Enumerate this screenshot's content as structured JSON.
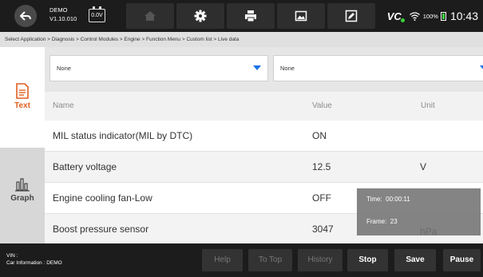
{
  "app": {
    "name": "DEMO",
    "version": "V1.10.010",
    "voltage": "0.0V"
  },
  "status": {
    "vci_label": "VC",
    "battery": "100%",
    "time": "10:43"
  },
  "breadcrumb": "Select Application > Diagnosis > Control Modules > Engine > Function Menu > Custom list >  Live data",
  "sidebar": {
    "tabs": [
      {
        "label": "Text",
        "active": true
      },
      {
        "label": "Graph",
        "active": false
      }
    ]
  },
  "selectors": [
    {
      "value": "None"
    },
    {
      "value": "None"
    }
  ],
  "table": {
    "headers": {
      "name": "Name",
      "value": "Value",
      "unit": "Unit"
    },
    "rows": [
      {
        "name": "MIL status indicator(MIL by DTC)",
        "value": "ON",
        "unit": ""
      },
      {
        "name": "Battery voltage",
        "value": "12.5",
        "unit": "V"
      },
      {
        "name": "Engine cooling fan-Low",
        "value": "OFF",
        "unit": ""
      },
      {
        "name": "Boost pressure sensor",
        "value": "3047",
        "unit": "hPa"
      }
    ]
  },
  "tooltip": {
    "time_label": "Time:",
    "time_value": "00:00:11",
    "frame_label": "Frame:",
    "frame_value": "23"
  },
  "footer": {
    "vin_label": "VIN :",
    "car_info_label": "Car Information :",
    "car_info_value": "DEMO",
    "buttons": [
      {
        "label": "Help",
        "enabled": false
      },
      {
        "label": "To Top",
        "enabled": false
      },
      {
        "label": "History",
        "enabled": false
      },
      {
        "label": "Stop",
        "enabled": true
      },
      {
        "label": "Save",
        "enabled": true
      },
      {
        "label": "Pause",
        "enabled": true
      }
    ]
  },
  "colors": {
    "accent_orange": "#e06020",
    "dropdown_blue": "#1a73e8",
    "bar_dark": "#1c1c1c",
    "connected_green": "#3bd23b"
  }
}
